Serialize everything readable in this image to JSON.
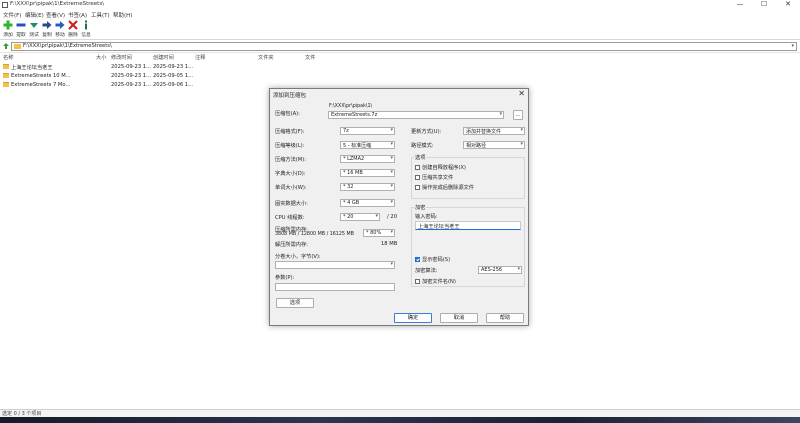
{
  "window": {
    "title": "F:\\XXX\\pr\\pipak\\1\\ExtremeStreets\\",
    "minimize": "—",
    "maximize": "☐",
    "close": "✕"
  },
  "menu": [
    "文件(F)",
    "编辑(E)",
    "查看(V)",
    "书签(A)",
    "工具(T)",
    "帮助(H)"
  ],
  "toolbar": [
    {
      "label": "添加",
      "icon": "plus-icon",
      "color": "#2db52d"
    },
    {
      "label": "提取",
      "icon": "minus-icon",
      "color": "#2a4fc4"
    },
    {
      "label": "测试",
      "icon": "check-icon",
      "color": "#1f8f6f"
    },
    {
      "label": "复制",
      "icon": "copy-arrow-icon",
      "color": "#2b4a8a"
    },
    {
      "label": "移动",
      "icon": "move-arrow-icon",
      "color": "#1e5fc7"
    },
    {
      "label": "删除",
      "icon": "delete-x-icon",
      "color": "#d21f1f"
    },
    {
      "label": "信息",
      "icon": "info-icon",
      "color": "#1a7a3a"
    }
  ],
  "address": {
    "path": "F:\\XXX\\pr\\pipak\\1\\ExtremeStreets\\"
  },
  "columns": [
    "名称",
    "大小",
    "修改时间",
    "创建时间",
    "注释",
    "文件夹",
    "文件"
  ],
  "files": [
    {
      "name": "上海王论坛当老王",
      "modified": "2025-09-23 1...",
      "created": "2025-09-23 1..."
    },
    {
      "name": "ExtremeStreets 10 M...",
      "modified": "2025-09-23 1...",
      "created": "2025-09-05 1..."
    },
    {
      "name": "ExtremeStreets 7 Mo...",
      "modified": "2025-09-23 1...",
      "created": "2025-09-06 1..."
    }
  ],
  "status": "选定 0 / 3 个项目",
  "dialog": {
    "title": "添加到压缩包",
    "close": "✕",
    "archive_label": "压缩包(A):",
    "archive_dir": "F:\\XXX\\pr\\pipak\\1\\",
    "archive_name": "ExtremeStreets.7z",
    "browse": "...",
    "left_fields": [
      {
        "label": "压缩格式(F):",
        "value": "7z"
      },
      {
        "label": "压缩等级(L):",
        "value": "5 - 标准压缩"
      },
      {
        "label": "压缩方法(M):",
        "value": "* LZMA2"
      },
      {
        "label": "字典大小(D):",
        "value": "* 16 MB"
      },
      {
        "label": "单词大小(W):",
        "value": "* 32"
      },
      {
        "label": "固实数据大小:",
        "value": "* 4 GB"
      }
    ],
    "cpu_label": "CPU 线程数:",
    "cpu_value": "* 20",
    "cpu_max": "/ 20",
    "mem_label": "压缩所需内存:",
    "mem_detail": "3808 MB / 12800 MB / 16125 MB",
    "mem_percent": "* 80%",
    "decomp_label": "解压所需内存:",
    "decomp_value": "18 MB",
    "split_label": "分卷大小，字节(V):",
    "params_label": "参数(P):",
    "options_button": "选项",
    "update_label": "更新方式(U):",
    "update_value": "添加并替换文件",
    "path_label": "路径模式:",
    "path_value": "相对路径",
    "options_group": "选项",
    "options": [
      {
        "label": "创建自释放程序(X)",
        "checked": false
      },
      {
        "label": "压缩共享文件",
        "checked": false
      },
      {
        "label": "操作完成后删除源文件",
        "checked": false
      }
    ],
    "encrypt_group": "加密",
    "pwd_label": "输入密码:",
    "pwd_value": "上海王论坛当老王",
    "show_pwd_label": "显示密码(S)",
    "show_pwd_checked": true,
    "enc_method_label": "加密算法:",
    "enc_method_value": "AES-256",
    "encrypt_names_label": "加密文件名(N)",
    "encrypt_names_checked": false,
    "ok": "确定",
    "cancel": "取消",
    "help": "帮助"
  }
}
